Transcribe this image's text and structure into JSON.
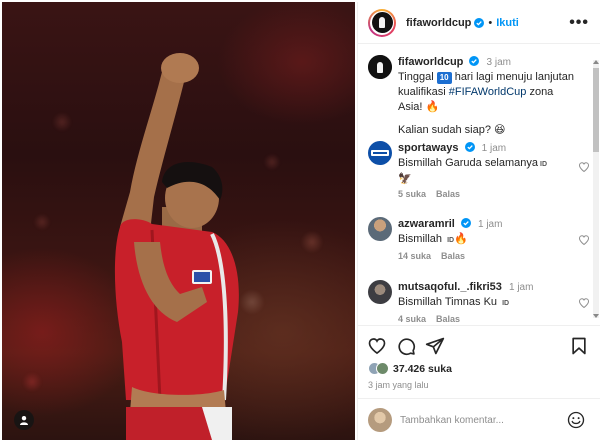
{
  "post": {
    "username": "fifaworldcup",
    "follow_label": "Ikuti",
    "more_label": "•••",
    "caption": {
      "username": "fifaworldcup",
      "time": "3 jam",
      "text_before": "Tinggal ",
      "days_badge": "10",
      "text_mid": " hari lagi menuju lanjutan kualifikasi ",
      "hashtag": "#FIFAWorldCup",
      "text_after": " zona Asia! 🔥",
      "second_line": "Kalian sudah siap? 😆"
    },
    "likes": "37.426 suka",
    "posted_time": "3 jam yang lalu"
  },
  "comments": [
    {
      "username": "sportaways",
      "time": "1 jam",
      "text": "Bismillah Garuda selamanya",
      "flag": "ID",
      "extra": "🦅",
      "likes": "5 suka",
      "reply": "Balas"
    },
    {
      "username": "azwaramril",
      "time": "1 jam",
      "text": "Bismillah ",
      "flag": "ID",
      "extra": "🔥",
      "likes": "14 suka",
      "reply": "Balas"
    },
    {
      "username": "mutsaqoful._.fikri53",
      "time": "1 jam",
      "text": "Bismillah Timnas Ku ",
      "flag": "ID",
      "extra": "",
      "likes": "4 suka",
      "reply": "Balas"
    }
  ],
  "composer": {
    "placeholder": "Tambahkan komentar..."
  },
  "icons": {
    "like": "heart-icon",
    "comment": "comment-icon",
    "share": "share-icon",
    "save": "bookmark-icon",
    "emoji": "emoji-icon"
  },
  "colors": {
    "accent": "#0095f6",
    "hashtag": "#00376b",
    "verified": "#0095f6"
  }
}
